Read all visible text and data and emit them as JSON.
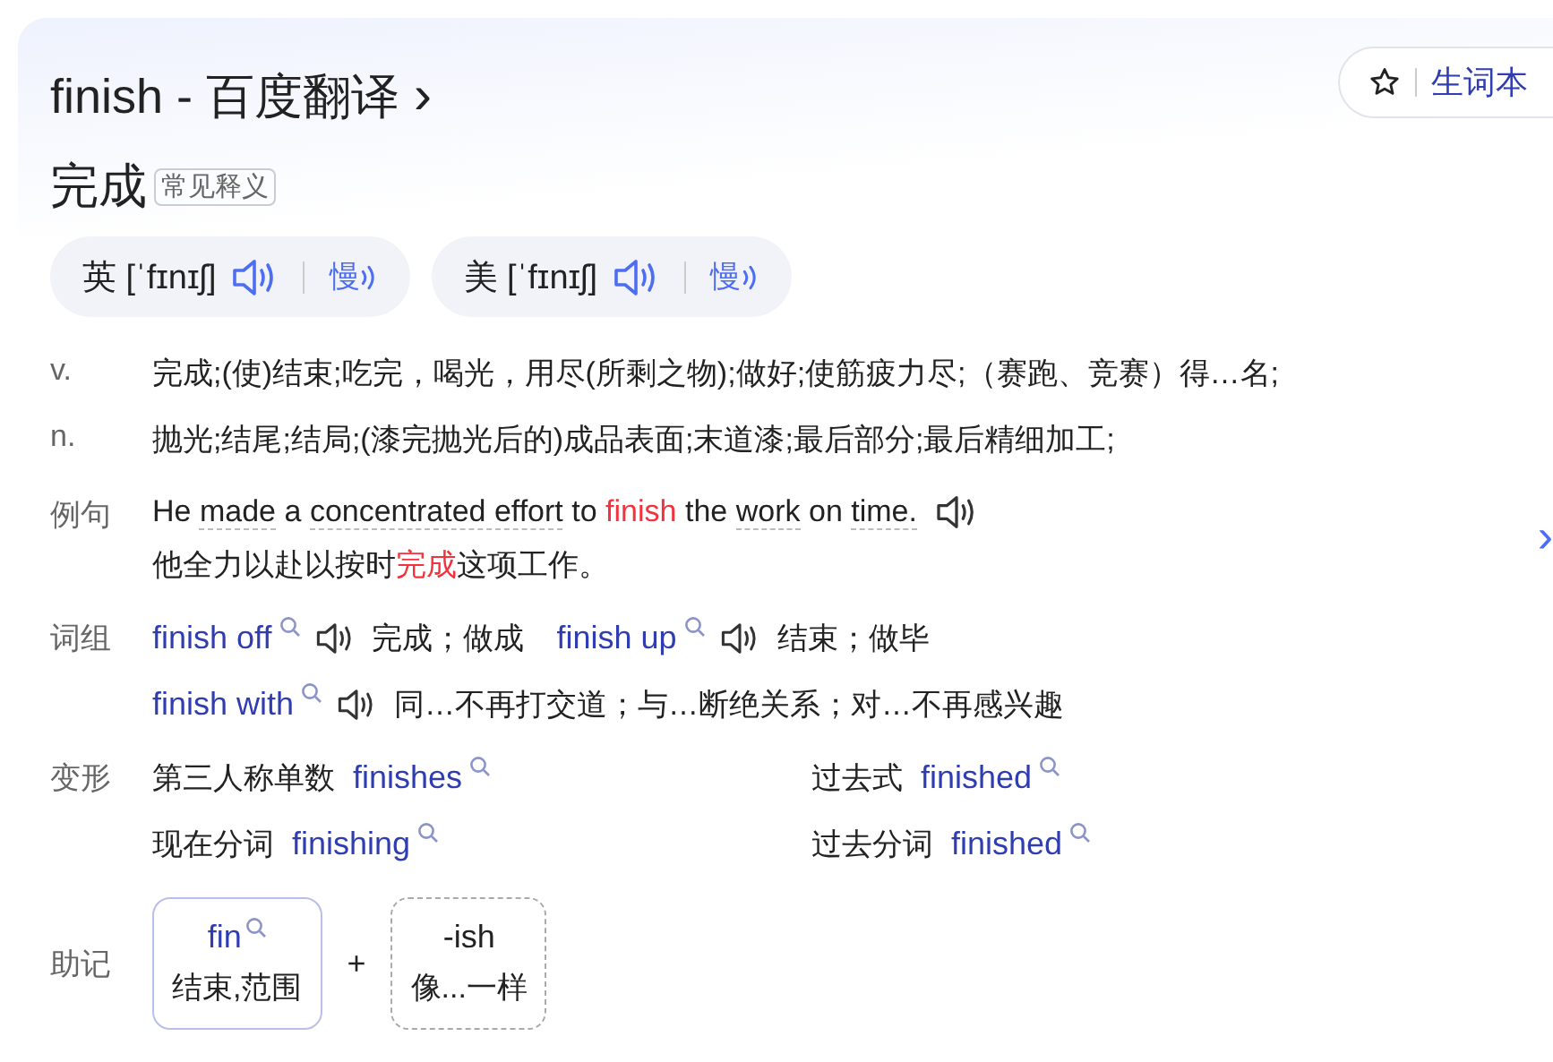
{
  "header": {
    "title": "finish - 百度翻译",
    "chevron": "›",
    "wordbook_label": "生词本"
  },
  "main_meaning": {
    "text": "完成",
    "tag": "常见释义"
  },
  "pronunciations": [
    {
      "region": "英",
      "ipa": "[ˈfɪnɪʃ]",
      "slow": "慢"
    },
    {
      "region": "美",
      "ipa": "[ˈfɪnɪʃ]",
      "slow": "慢"
    }
  ],
  "definitions": [
    {
      "pos": "v.",
      "text": "完成;(使)结束;吃完，喝光，用尽(所剩之物);做好;使筋疲力尽;（赛跑、竞赛）得…名;"
    },
    {
      "pos": "n.",
      "text": "抛光;结尾;结局;(漆完抛光后的)成品表面;末道漆;最后部分;最后精细加工;"
    }
  ],
  "example": {
    "label": "例句",
    "segments": [
      {
        "text": "He",
        "kind": "plain"
      },
      {
        "text": "made",
        "kind": "word"
      },
      {
        "text": "a",
        "kind": "plain"
      },
      {
        "text": "concentrated effort",
        "kind": "word"
      },
      {
        "text": "to",
        "kind": "plain"
      },
      {
        "text": "finish",
        "kind": "highlight"
      },
      {
        "text": "the",
        "kind": "plain"
      },
      {
        "text": "work",
        "kind": "word"
      },
      {
        "text": "on",
        "kind": "plain"
      },
      {
        "text": "time.",
        "kind": "word"
      }
    ],
    "translation": [
      {
        "text": "他全力以赴以按时",
        "kind": "plain"
      },
      {
        "text": "完成",
        "kind": "highlight"
      },
      {
        "text": "这项工作。",
        "kind": "plain"
      }
    ],
    "next": "›"
  },
  "phrases": {
    "label": "词组",
    "rows": [
      [
        {
          "phrase": "finish off",
          "meaning": "完成；做成"
        },
        {
          "phrase": "finish up",
          "meaning": "结束；做毕"
        }
      ],
      [
        {
          "phrase": "finish with",
          "meaning": "同…不再打交道；与…断绝关系；对…不再感兴趣"
        }
      ]
    ]
  },
  "inflections": {
    "label": "变形",
    "items": [
      {
        "form": "第三人称单数",
        "word": "finishes"
      },
      {
        "form": "过去式",
        "word": "finished"
      },
      {
        "form": "现在分词",
        "word": "finishing"
      },
      {
        "form": "过去分词",
        "word": "finished"
      }
    ]
  },
  "mnemonic": {
    "label": "助记",
    "plus": "+",
    "parts": [
      {
        "kind": "root",
        "part": "fin",
        "meaning": "结束,范围"
      },
      {
        "kind": "suffix",
        "part": "-ish",
        "meaning": "像...一样"
      }
    ]
  }
}
